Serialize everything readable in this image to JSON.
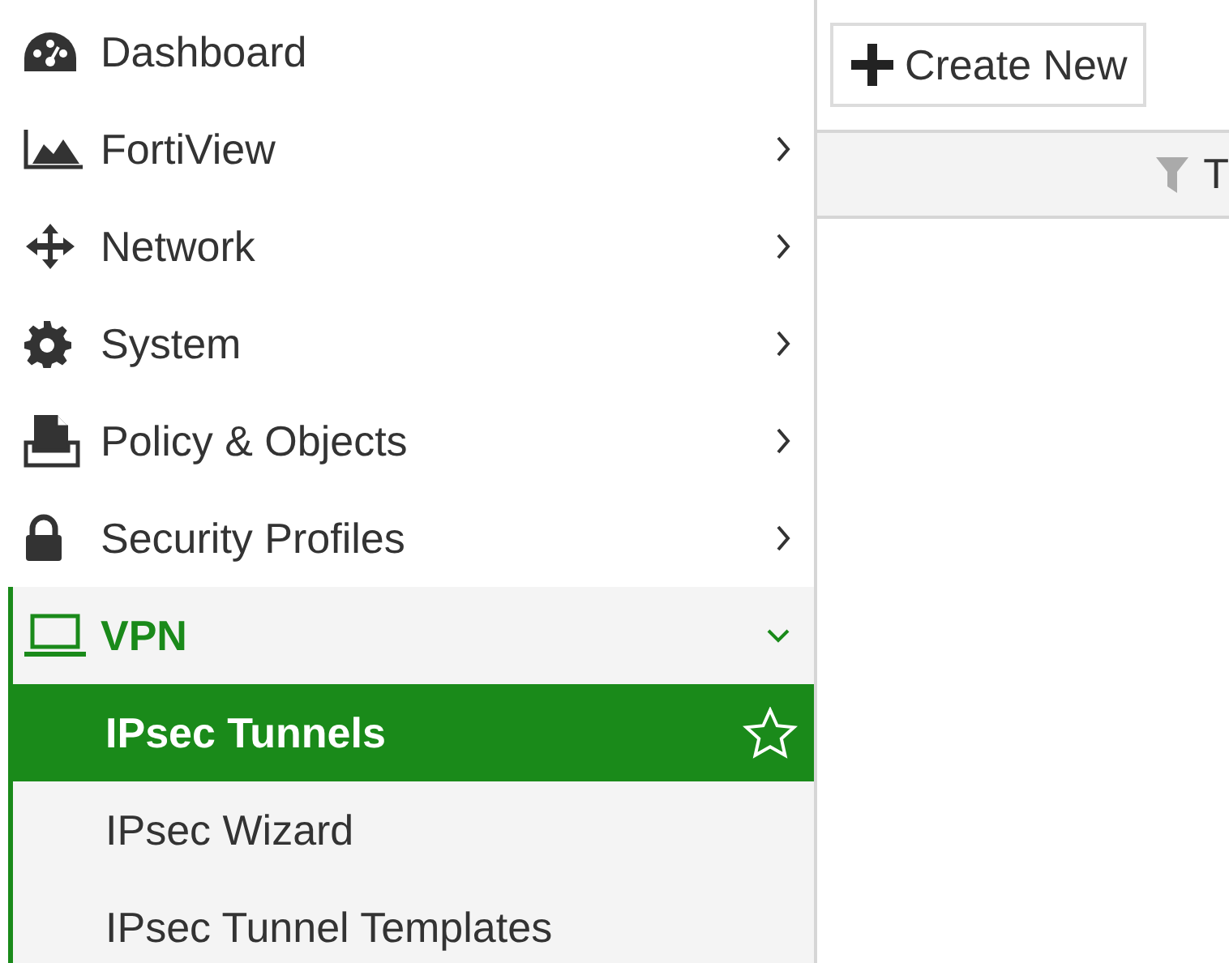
{
  "sidebar": {
    "items": [
      {
        "label": "Dashboard",
        "kind": "link"
      },
      {
        "label": "FortiView",
        "kind": "group",
        "expanded": false
      },
      {
        "label": "Network",
        "kind": "group",
        "expanded": false
      },
      {
        "label": "System",
        "kind": "group",
        "expanded": false
      },
      {
        "label": "Policy & Objects",
        "kind": "group",
        "expanded": false
      },
      {
        "label": "Security Profiles",
        "kind": "group",
        "expanded": false
      },
      {
        "label": "VPN",
        "kind": "group",
        "expanded": true,
        "children": [
          {
            "label": "IPsec Tunnels",
            "selected": true
          },
          {
            "label": "IPsec Wizard",
            "selected": false
          },
          {
            "label": "IPsec Tunnel Templates",
            "selected": false
          }
        ]
      }
    ]
  },
  "toolbar": {
    "create_button": "Create New"
  },
  "table": {
    "columns": [
      {
        "label": "T"
      }
    ]
  }
}
